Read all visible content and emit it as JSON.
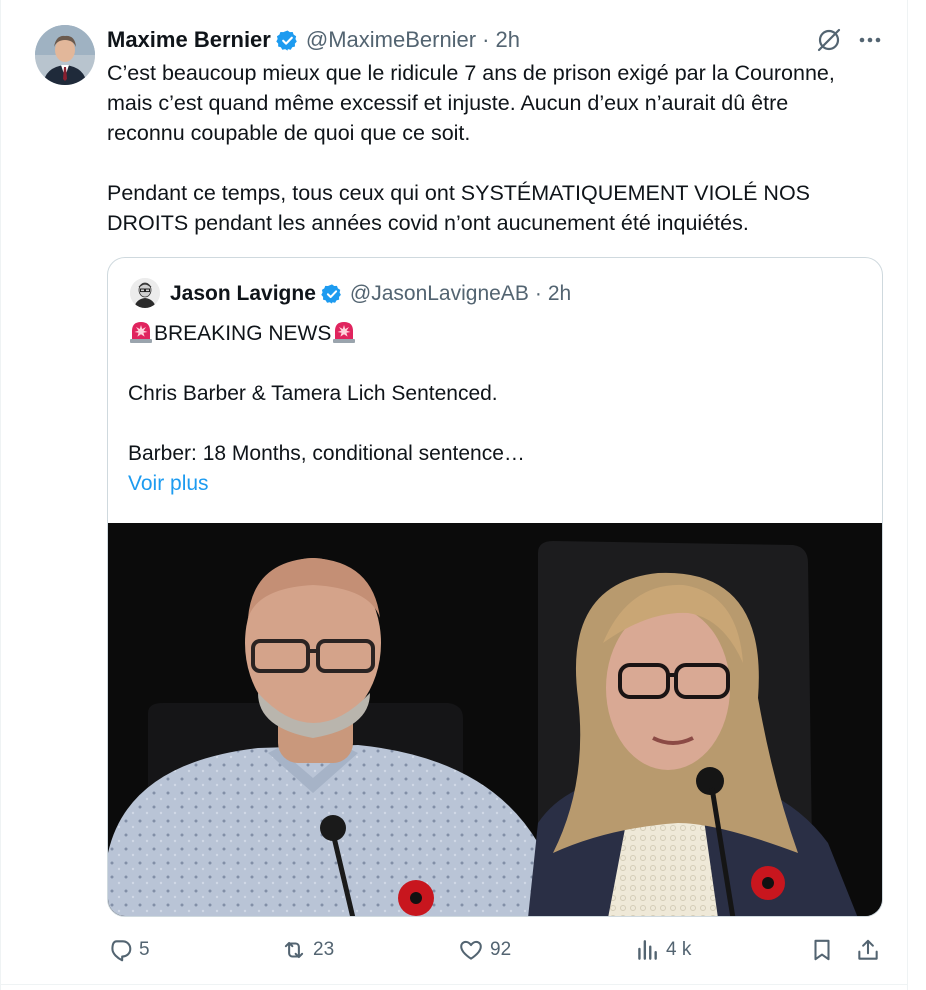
{
  "tweet": {
    "author_name": "Maxime Bernier",
    "author_handle": "@MaximeBernier",
    "dot": "·",
    "time": "2h",
    "text_lines": [
      "C’est beaucoup mieux que le ridicule 7 ans de prison exigé par la Couronne,",
      "mais c’est quand même excessif et injuste. Aucun d’eux n’aurait dû être",
      "reconnu coupable de quoi que ce soit.",
      "Pendant ce temps, tous ceux qui ont SYSTÉMATIQUEMENT VIOLÉ NOS",
      "DROITS pendant les années covid n’ont aucunement été inquiétés."
    ]
  },
  "quote": {
    "author_name": "Jason Lavigne",
    "author_handle": "@JasonLavigneAB",
    "dot": "·",
    "time": "2h",
    "headline": "BREAKING NEWS",
    "line1": "Chris Barber & Tamera Lich Sentenced.",
    "line2": "Barber: 18 Months, conditional sentence…",
    "show_more": "Voir plus"
  },
  "actions": {
    "replies": "5",
    "retweets": "23",
    "likes": "92",
    "views": "4 k"
  },
  "colors": {
    "verified": "#1d9bf0",
    "link": "#1d9bf0",
    "muted": "#536471",
    "text": "#0f1419",
    "siren": "#e0245e"
  },
  "icons": [
    "verified-badge-icon",
    "grok-icon",
    "more-icon",
    "siren-icon",
    "reply-icon",
    "retweet-icon",
    "like-icon",
    "views-icon",
    "bookmark-icon",
    "share-icon"
  ]
}
